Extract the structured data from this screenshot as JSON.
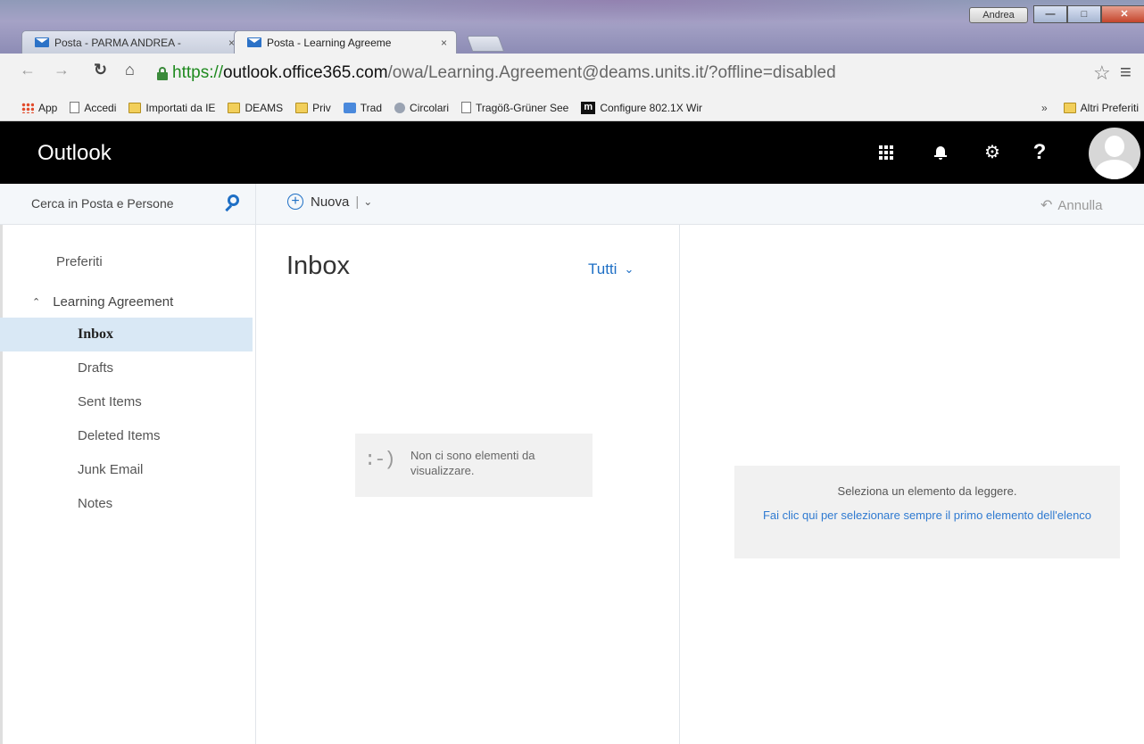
{
  "browser": {
    "user_badge": "Andrea",
    "tabs": [
      {
        "title": "Posta - PARMA ANDREA -",
        "active": false
      },
      {
        "title": "Posta - Learning Agreeme",
        "active": true
      }
    ],
    "tab_close": "×",
    "url": {
      "scheme": "https://",
      "host": "outlook.office365.com",
      "path": "/owa/Learning.Agreement@deams.units.it/?offline=disabled"
    },
    "bookmarks": [
      {
        "label": "App",
        "icon": "apps-icon"
      },
      {
        "label": "Accedi",
        "icon": "page-icon"
      },
      {
        "label": "Importati da IE",
        "icon": "folder-icon"
      },
      {
        "label": "DEAMS",
        "icon": "folder-icon"
      },
      {
        "label": "Priv",
        "icon": "folder-icon"
      },
      {
        "label": "Trad",
        "icon": "translate-icon"
      },
      {
        "label": "Circolari",
        "icon": "circle-icon"
      },
      {
        "label": "Tragöß-Grüner See",
        "icon": "page-icon"
      },
      {
        "label": "Configure 802.1X Wir",
        "icon": "m-icon"
      }
    ],
    "bookmarks_overflow": "»",
    "other_bookmarks": "Altri Preferiti"
  },
  "outlook": {
    "brand": "Outlook",
    "search_placeholder": "Cerca in Posta e Persone",
    "new_label": "Nuova",
    "undo_label": "Annulla",
    "favorites": "Preferiti",
    "account": "Learning Agreement",
    "folders": [
      "Inbox",
      "Drafts",
      "Sent Items",
      "Deleted Items",
      "Junk Email",
      "Notes"
    ],
    "selected_folder": "Inbox",
    "list_title": "Inbox",
    "filter_label": "Tutti",
    "empty_smiley": ":-)",
    "empty_message": "Non ci sono elementi da visualizzare.",
    "reading_message": "Seleziona un elemento da leggere.",
    "reading_link": "Fai clic qui per selezionare sempre il primo elemento dell'elenco"
  },
  "colors": {
    "accent": "#1e6fc5",
    "header_bg": "#000000",
    "selected_folder_bg": "#d9e8f5"
  }
}
